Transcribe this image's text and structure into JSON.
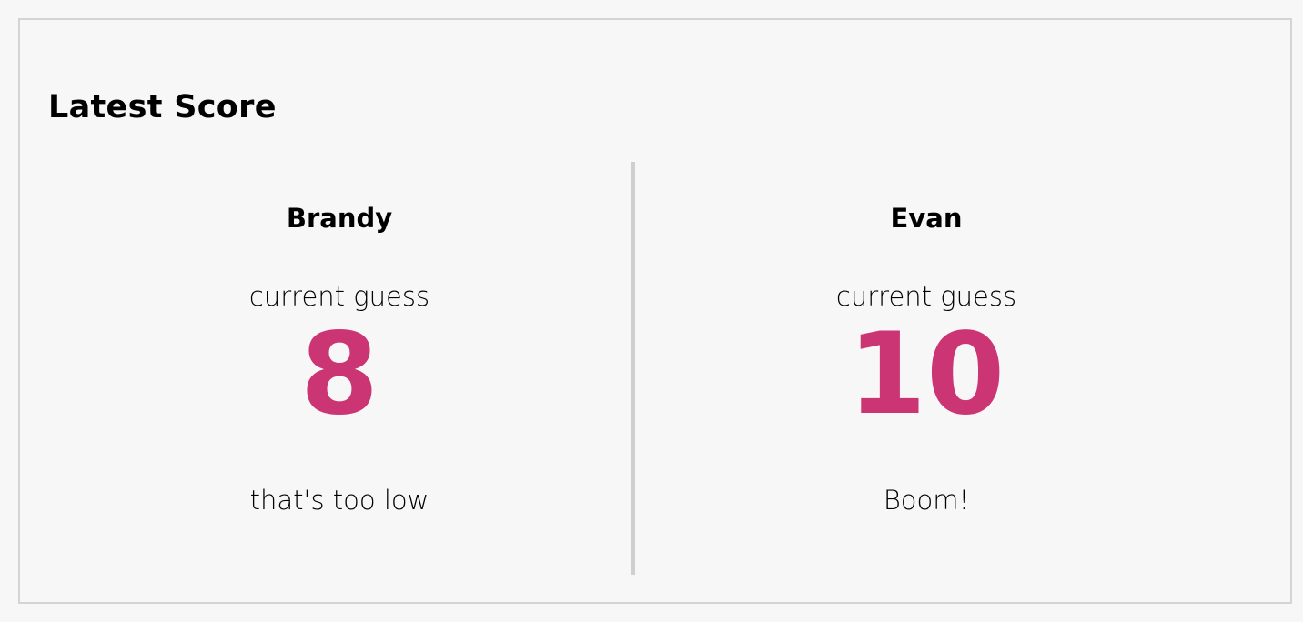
{
  "panel": {
    "title": "Latest Score"
  },
  "players": [
    {
      "name": "Brandy",
      "guess_label": "current guess",
      "guess": "8",
      "feedback": "that's too low"
    },
    {
      "name": "Evan",
      "guess_label": "current guess",
      "guess": "10",
      "feedback": "Boom!"
    }
  ],
  "colors": {
    "guess_number": "#cc3574",
    "background": "#f7f7f7",
    "border": "#d4d4d4",
    "divider": "#cfcfcf"
  }
}
